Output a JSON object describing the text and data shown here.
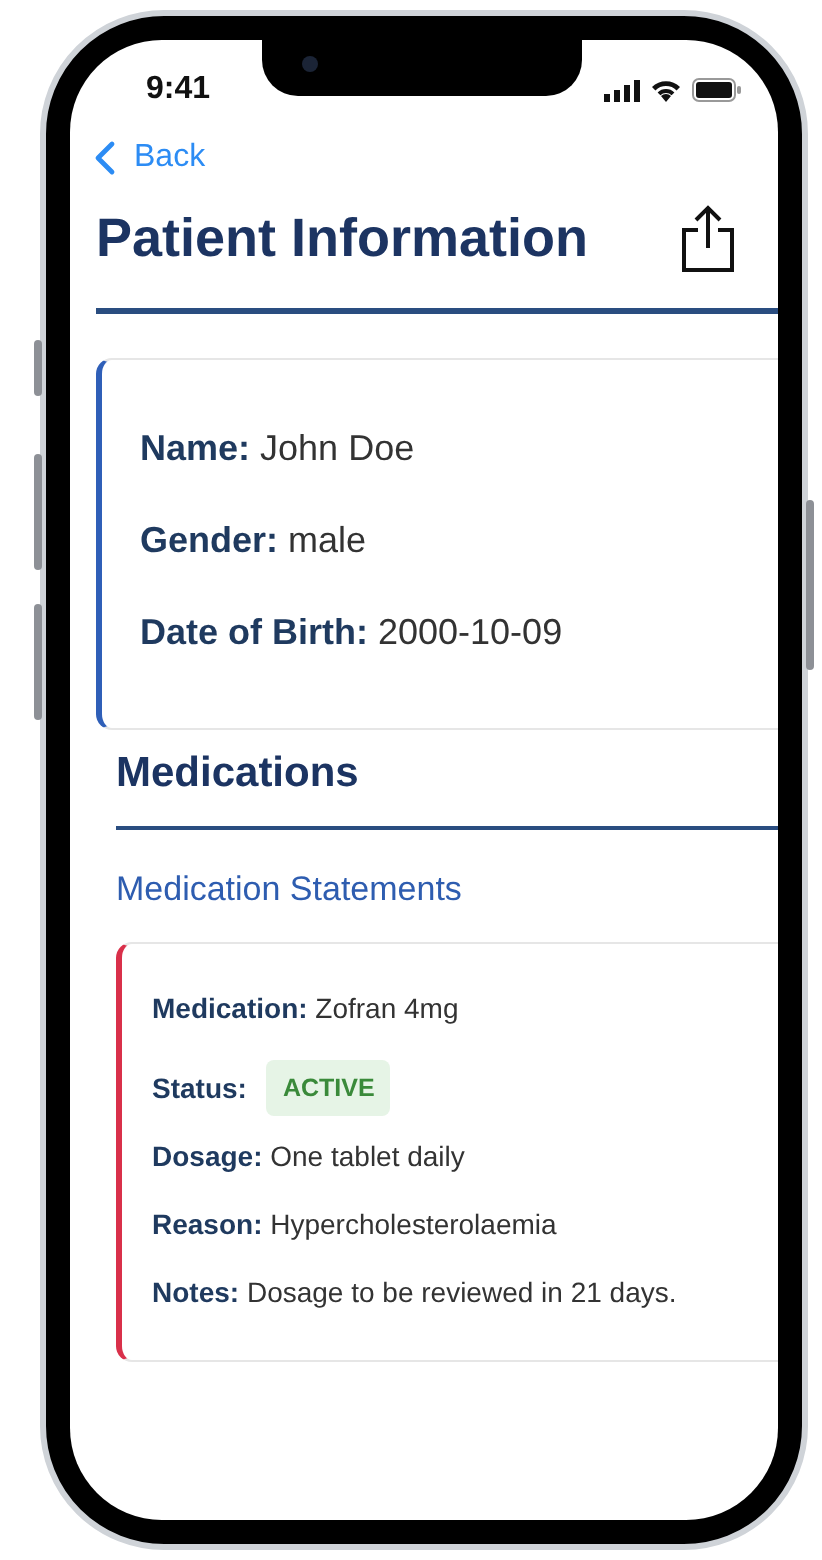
{
  "status_bar": {
    "time": "9:41"
  },
  "nav": {
    "back": "Back"
  },
  "title": "Patient Information",
  "patient": {
    "fields": [
      {
        "label": "Name:",
        "value": "John Doe"
      },
      {
        "label": "Gender:",
        "value": "male"
      },
      {
        "label": "Date of Birth:",
        "value": "2000-10-09"
      }
    ]
  },
  "medications": {
    "heading": "Medications",
    "subheading": "Medication Statements",
    "statements": [
      {
        "fields": [
          {
            "kind": "text",
            "label": "Medication:",
            "value": "Zofran 4mg"
          },
          {
            "kind": "badge",
            "label": "Status:",
            "value": "ACTIVE"
          },
          {
            "kind": "text",
            "label": "Dosage:",
            "value": "One tablet daily"
          },
          {
            "kind": "text",
            "label": "Reason:",
            "value": "Hypercholesterolaemia"
          },
          {
            "kind": "text",
            "label": "Notes:",
            "value": "Dosage to be reviewed in 21 days."
          }
        ]
      }
    ]
  }
}
